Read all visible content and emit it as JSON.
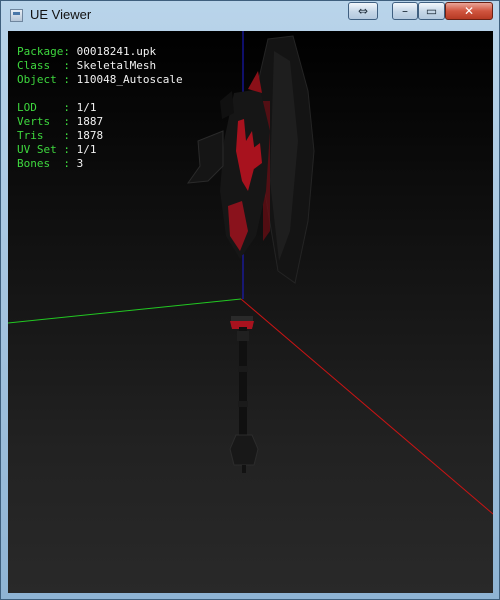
{
  "window": {
    "title": "UE Viewer",
    "buttons": {
      "swap": "⇔",
      "minimize": "–",
      "maximize": "▭",
      "close": "✕"
    }
  },
  "info": {
    "package_key": "Package:",
    "package_value": "00018241.upk",
    "class_key": "Class  :",
    "class_value": "SkeletalMesh",
    "object_key": "Object :",
    "object_value": "110048_Autoscale",
    "lod_key": "LOD    :",
    "lod_value": "1/1",
    "verts_key": "Verts  :",
    "verts_value": "1887",
    "tris_key": "Tris   :",
    "tris_value": "1878",
    "uvset_key": "UV Set :",
    "uvset_value": "1/1",
    "bones_key": "Bones  :",
    "bones_value": "3"
  },
  "colors": {
    "label_green": "#3ed83e",
    "value_white": "#f2f2f2",
    "axis_x": "#c81414",
    "axis_y": "#22c822",
    "axis_z": "#1c1cd2",
    "mesh_dark": "#141414",
    "mesh_red": "#a8121e"
  },
  "icons": {
    "app": "app-window-icon"
  }
}
